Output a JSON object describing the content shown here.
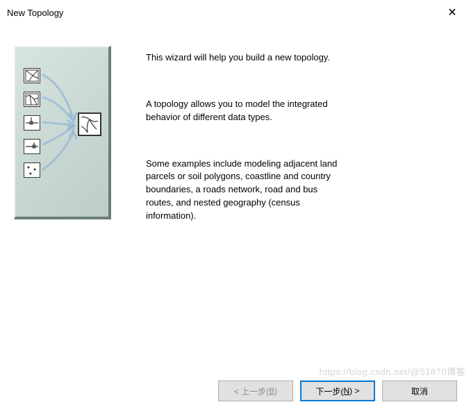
{
  "window": {
    "title": "New Topology",
    "close_glyph": "✕"
  },
  "wizard": {
    "para1": "This wizard will help you build a new topology.",
    "para2": "A topology allows you to model the integrated behavior of different data types.",
    "para3": "Some examples include modeling adjacent land parcels or soil polygons, coastline and country boundaries, a roads network, road and bus routes, and nested geography (census information)."
  },
  "buttons": {
    "back_prefix": "< 上一步(",
    "back_hotkey": "B",
    "back_suffix": ")",
    "next_prefix": "下一步(",
    "next_hotkey": "N",
    "next_suffix": ") >",
    "cancel": "取消"
  },
  "watermark": "https://blog.csdn.net/@51870博客"
}
